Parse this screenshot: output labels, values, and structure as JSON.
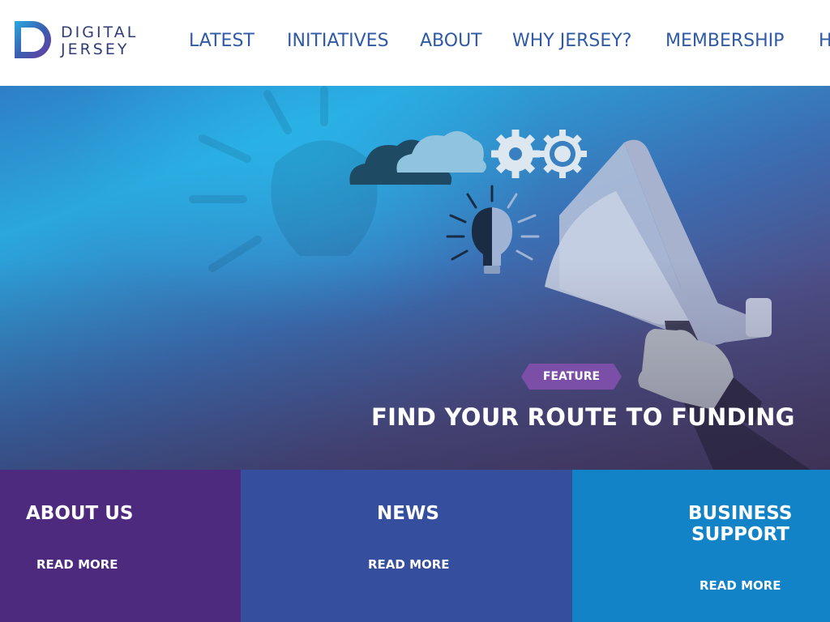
{
  "header": {
    "logo": {
      "line1": "DIGITAL",
      "line2": "JERSEY"
    },
    "nav": [
      {
        "label": "LATEST"
      },
      {
        "label": "INITIATIVES"
      },
      {
        "label": "ABOUT"
      },
      {
        "label": "WHY JERSEY?"
      },
      {
        "label": "MEMBERSHIP"
      },
      {
        "label": "H"
      }
    ]
  },
  "hero": {
    "badge": "FEATURE",
    "title": "FIND YOUR ROUTE TO FUNDING",
    "illustration_icons": [
      "cloud-icon",
      "gear-icon",
      "lightbulb-icon",
      "megaphone-icon",
      "hand-icon"
    ]
  },
  "panels": [
    {
      "title": "ABOUT US",
      "link": "READ MORE",
      "color": "#4e2a7f"
    },
    {
      "title": "NEWS",
      "link": "READ MORE",
      "color": "#354f9e"
    },
    {
      "title_line1": "BUSINESS",
      "title_line2": "SUPPORT",
      "link": "READ MORE",
      "color": "#1283c7"
    }
  ],
  "colors": {
    "nav_text": "#2f5aa5",
    "logo_text": "#2f3e78",
    "badge": "#7b4fa8"
  }
}
